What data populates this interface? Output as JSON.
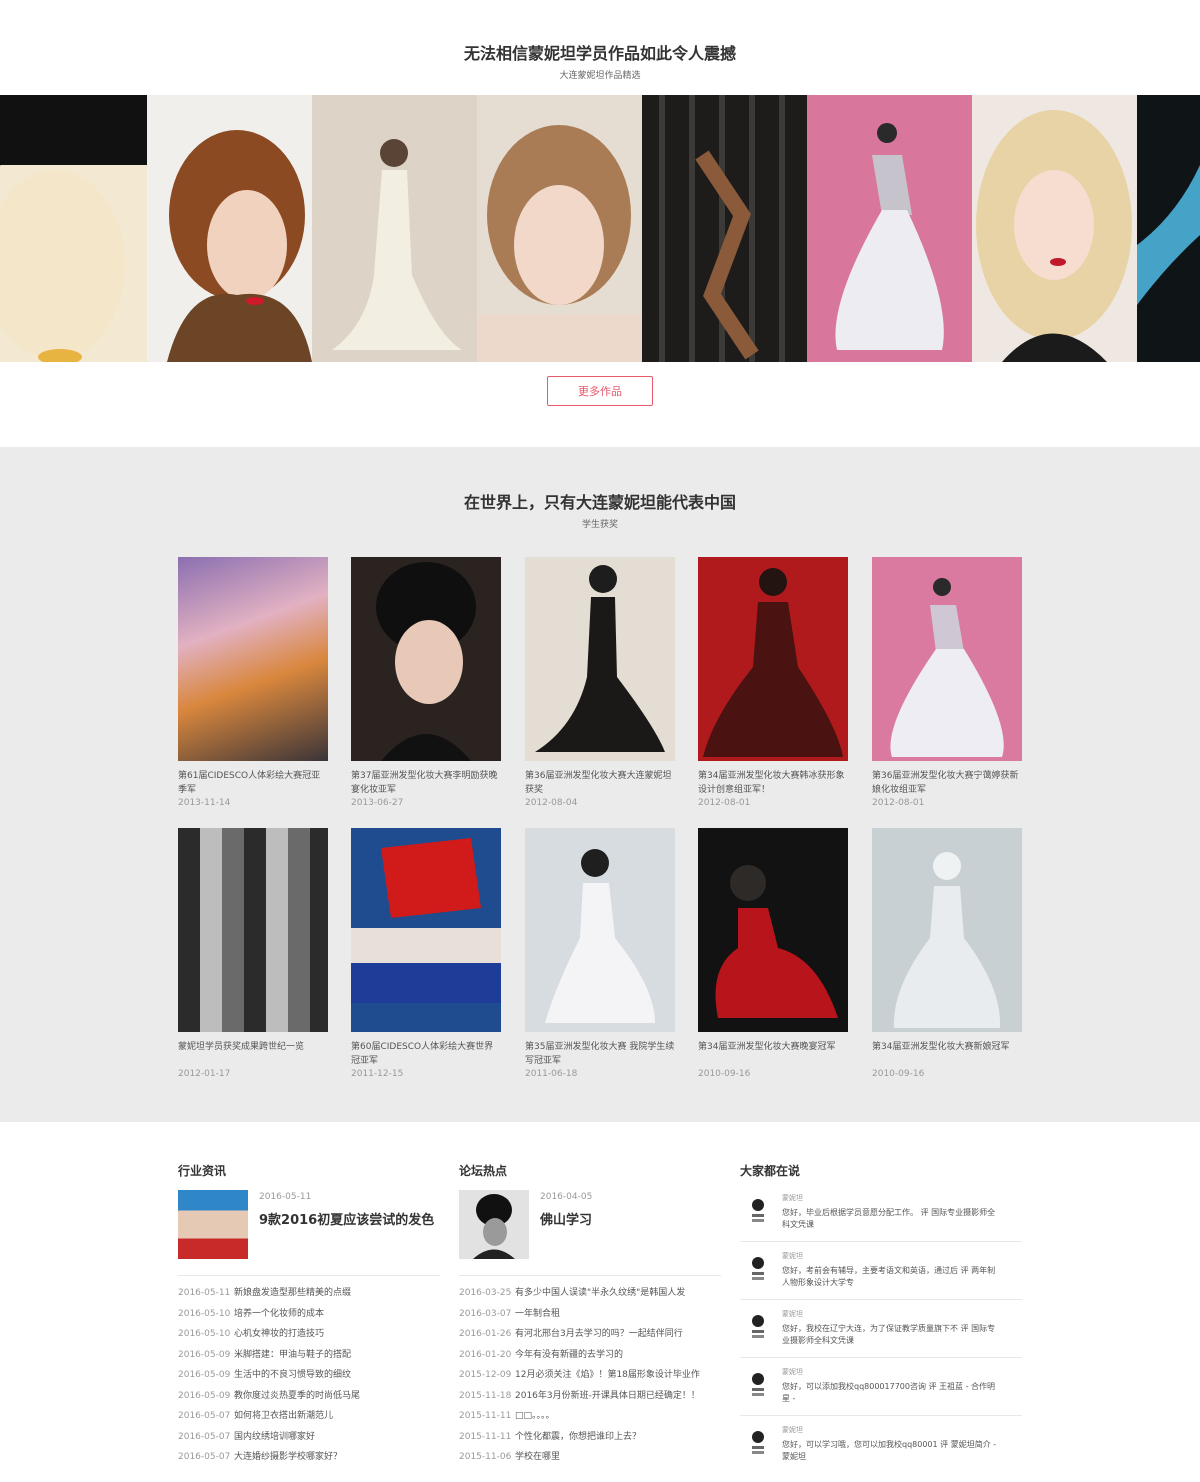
{
  "gallery": {
    "title": "无法相信蒙妮坦学员作品如此令人震撼",
    "subtitle": "大连蒙妮坦作品精选",
    "more_label": "更多作品"
  },
  "awards": {
    "title": "在世界上，只有大连蒙妮坦能代表中国",
    "subtitle": "学生获奖",
    "items": [
      {
        "caption": "第61届CIDESCO人体彩绘大赛冠亚季军",
        "date": "2013-11-14"
      },
      {
        "caption": "第37届亚洲发型化妆大赛李明励获晚宴化妆亚军",
        "date": "2013-06-27"
      },
      {
        "caption": "第36届亚洲发型化妆大赛大连蒙妮坦获奖",
        "date": "2012-08-04"
      },
      {
        "caption": "第34届亚洲发型化妆大赛韩冰获形象设计创意组亚军！",
        "date": "2012-08-01"
      },
      {
        "caption": "第36届亚洲发型化妆大赛宁蔼婷获新娘化妆组亚军",
        "date": "2012-08-01"
      },
      {
        "caption": "蒙妮坦学员获奖成果跨世纪一览",
        "date": "2012-01-17"
      },
      {
        "caption": "第60届CIDESCO人体彩绘大赛世界冠亚军",
        "date": "2011-12-15"
      },
      {
        "caption": "第35届亚洲发型化妆大赛 我院学生续写冠亚军",
        "date": "2011-06-18"
      },
      {
        "caption": "第34届亚洲发型化妆大赛晚宴冠军",
        "date": "2010-09-16"
      },
      {
        "caption": "第34届亚洲发型化妆大赛新娘冠军",
        "date": "2010-09-16"
      }
    ]
  },
  "industry": {
    "title": "行业资讯",
    "feature": {
      "date": "2016-05-11",
      "title": "9款2016初夏应该尝试的发色"
    },
    "list": [
      {
        "date": "2016-05-11",
        "title": "新娘盘发造型那些精美的点缀"
      },
      {
        "date": "2016-05-10",
        "title": "培养一个化妆师的成本"
      },
      {
        "date": "2016-05-10",
        "title": "心机女神妆的打造技巧"
      },
      {
        "date": "2016-05-09",
        "title": "米脚搭建：甲油与鞋子的搭配"
      },
      {
        "date": "2016-05-09",
        "title": "生活中的不良习惯导致的细纹"
      },
      {
        "date": "2016-05-09",
        "title": "教你度过炎热夏季的时尚低马尾"
      },
      {
        "date": "2016-05-07",
        "title": "如何将卫衣搭出新潮范儿"
      },
      {
        "date": "2016-05-07",
        "title": "国内纹绣培训哪家好"
      },
      {
        "date": "2016-05-07",
        "title": "大连婚纱摄影学校哪家好？"
      }
    ]
  },
  "forum": {
    "title": "论坛热点",
    "feature": {
      "date": "2016-04-05",
      "title": "佛山学习"
    },
    "list": [
      {
        "date": "2016-03-25",
        "title": "有多少中国人误读\"半永久纹绣\"是韩国人发"
      },
      {
        "date": "2016-03-07",
        "title": "一年制合租"
      },
      {
        "date": "2016-01-26",
        "title": "有河北邢台3月去学习的吗？一起结伴同行"
      },
      {
        "date": "2016-01-20",
        "title": "今年有没有新疆的去学习的"
      },
      {
        "date": "2015-12-09",
        "title": "12月必须关注《焰》！第18届形象设计毕业作"
      },
      {
        "date": "2015-11-18",
        "title": "2016年3月份新班-开课具体日期已经确定！！"
      },
      {
        "date": "2015-11-11",
        "title": "□□。。。。"
      },
      {
        "date": "2015-11-11",
        "title": "个性化都震，你想把谁印上去？"
      },
      {
        "date": "2015-11-06",
        "title": "学校在哪里"
      }
    ]
  },
  "comments": {
    "title": "大家都在说",
    "items": [
      {
        "who": "蒙妮坦",
        "text": "您好，毕业后根据学员意愿分配工作。 评 国际专业摄影师全科文凭课"
      },
      {
        "who": "蒙妮坦",
        "text": "您好，考前会有辅导，主要考语文和英语，通过后 评 两年制人物形象设计大学专"
      },
      {
        "who": "蒙妮坦",
        "text": "您好，我校在辽宁大连，为了保证教学质量旗下不 评 国际专业摄影师全科文凭课"
      },
      {
        "who": "蒙妮坦",
        "text": "您好，可以添加我校qq800017700咨询 评 王祖蓝 - 合作明星 -"
      },
      {
        "who": "蒙妮坦",
        "text": "您好，可以学习哦，您可以加我校qq80001 评 蒙妮坦简介 - 蒙妮坦"
      }
    ]
  }
}
